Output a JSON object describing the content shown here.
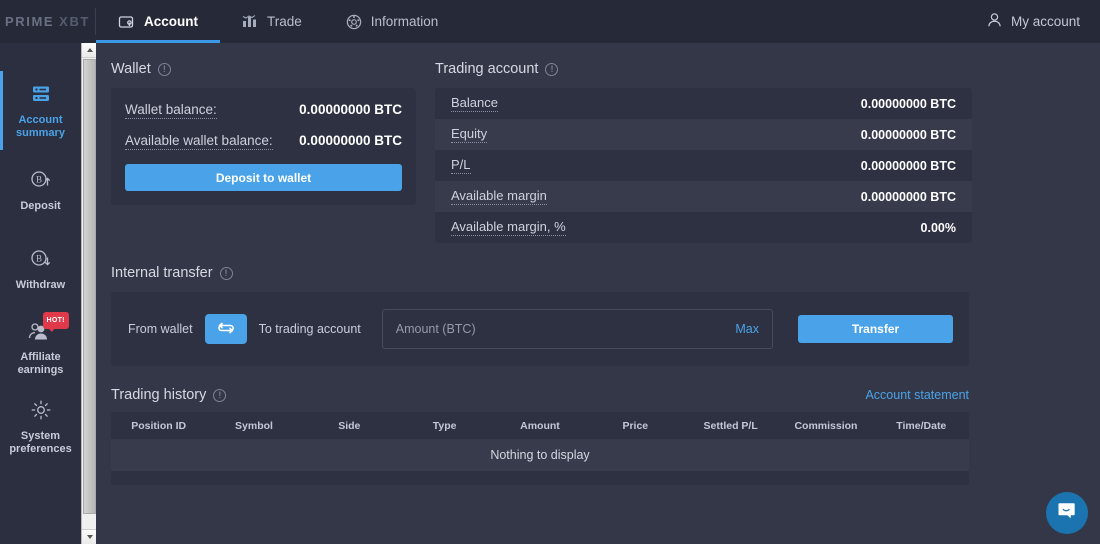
{
  "brand": {
    "prime": "PRIME",
    "xbt": "XBT"
  },
  "topnav": {
    "tabs": [
      {
        "label": "Account",
        "icon": "wallet-icon",
        "active": true
      },
      {
        "label": "Trade",
        "icon": "bar-chart-icon",
        "active": false
      },
      {
        "label": "Information",
        "icon": "info-circle-icon",
        "active": false
      }
    ],
    "my_account": "My account",
    "my_account_icon": "user-icon"
  },
  "sidebar": {
    "items": [
      {
        "label": "Account\nsummary",
        "icon": "dashboard-icon",
        "active": true,
        "badge": null
      },
      {
        "label": "Deposit",
        "icon": "bitcoin-up-icon",
        "active": false,
        "badge": null
      },
      {
        "label": "Withdraw",
        "icon": "bitcoin-down-icon",
        "active": false,
        "badge": null
      },
      {
        "label": "Affiliate\nearnings",
        "icon": "users-icon",
        "active": false,
        "badge": "HOT!"
      },
      {
        "label": "System\npreferences",
        "icon": "gear-icon",
        "active": false,
        "badge": null
      }
    ]
  },
  "wallet": {
    "title": "Wallet",
    "rows": [
      {
        "label": "Wallet balance:",
        "value": "0.00000000 BTC"
      },
      {
        "label": "Available wallet balance:",
        "value": "0.00000000 BTC"
      }
    ],
    "deposit_button": "Deposit to wallet"
  },
  "trading_account": {
    "title": "Trading account",
    "rows": [
      {
        "label": "Balance",
        "value": "0.00000000 BTC"
      },
      {
        "label": "Equity",
        "value": "0.00000000 BTC"
      },
      {
        "label": "P/L",
        "value": "0.00000000 BTC"
      },
      {
        "label": "Available margin",
        "value": "0.00000000 BTC"
      },
      {
        "label": "Available margin, %",
        "value": "0.00%"
      }
    ]
  },
  "internal_transfer": {
    "title": "Internal transfer",
    "from_label": "From wallet",
    "to_label": "To trading account",
    "swap_icon": "swap-arrows-icon",
    "amount_placeholder": "Amount (BTC)",
    "amount_value": "",
    "max_label": "Max",
    "transfer_button": "Transfer"
  },
  "trading_history": {
    "title": "Trading history",
    "account_statement": "Account statement",
    "columns": [
      "Position ID",
      "Symbol",
      "Side",
      "Type",
      "Amount",
      "Price",
      "Settled P/L",
      "Commission",
      "Time/Date"
    ],
    "rows": [],
    "empty_text": "Nothing to display"
  },
  "chat": {
    "icon": "chat-smile-icon"
  },
  "colors": {
    "accent": "#4aa3e8",
    "app_bg": "#343747",
    "panel_bg": "#2e3141",
    "panel_alt": "#383b4b",
    "topbar_bg": "#262a38",
    "sidebar_bg": "#2b2f40",
    "badge_red": "#e0394a",
    "chat_blue": "#1b74b0"
  }
}
